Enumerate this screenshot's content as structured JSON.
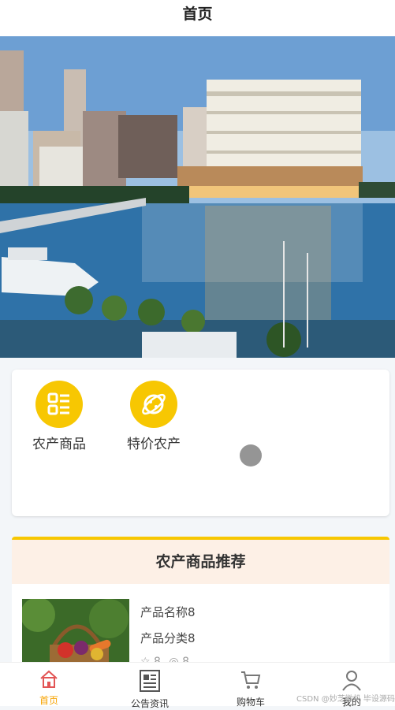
{
  "header": {
    "title": "首页"
  },
  "categories": [
    {
      "label": "农产商品",
      "icon": "list-icon"
    },
    {
      "label": "特价农产",
      "icon": "planet-icon"
    }
  ],
  "recommend": {
    "title": "农产商品推荐",
    "product": {
      "name": "产品名称8",
      "category": "产品分类8",
      "likes": "8",
      "views": "8"
    }
  },
  "tabbar": [
    {
      "label": "首页",
      "icon": "home-icon",
      "active": true
    },
    {
      "label": "公告资讯",
      "icon": "news-icon",
      "active": false
    },
    {
      "label": "购物车",
      "icon": "cart-icon",
      "active": false
    },
    {
      "label": "我的",
      "icon": "user-icon",
      "active": false
    }
  ],
  "colors": {
    "accent": "#f7c702",
    "active_tab": "#f7a300",
    "rec_header_bg": "#fdf0e6"
  },
  "watermark": "CSDN @妙芝微机 毕设源码"
}
